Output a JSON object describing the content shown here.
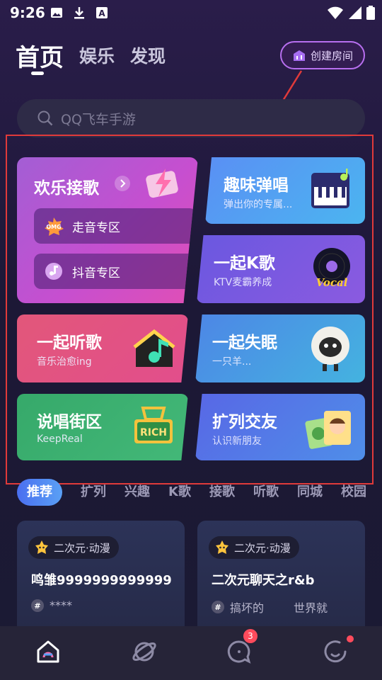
{
  "status_bar": {
    "time": "9:26"
  },
  "top_tabs": [
    {
      "label": "首页",
      "active": true
    },
    {
      "label": "娱乐"
    },
    {
      "label": "发现"
    }
  ],
  "create_room_label": "创建房间",
  "search": {
    "placeholder": "QQ飞车手游"
  },
  "cards": {
    "huanle": {
      "title": "欢乐接歌",
      "zones": [
        "走音专区",
        "抖音专区"
      ]
    },
    "quwei": {
      "title": "趣味弹唱",
      "sub": "弹出你的专属..."
    },
    "ktv": {
      "title": "一起K歌",
      "sub": "KTV麦霸养成",
      "badge": "Vocal"
    },
    "tingge": {
      "title": "一起听歌",
      "sub": "音乐治愈ing"
    },
    "shimian": {
      "title": "一起失眠",
      "sub": "一只羊..."
    },
    "shuochang": {
      "title": "说唱街区",
      "sub": "KeepReal",
      "badge": "RICH"
    },
    "kuolie": {
      "title": "扩列交友",
      "sub": "认识新朋友"
    }
  },
  "categories": [
    "推荐",
    "扩列",
    "兴趣",
    "K歌",
    "接歌",
    "听歌",
    "同城",
    "校园"
  ],
  "rooms": [
    {
      "tag": "二次元·动漫",
      "title": "鸣雏9999999999999",
      "meta": "****",
      "meta2": ""
    },
    {
      "tag": "二次元·动漫",
      "title": "二次元聊天之r&b",
      "meta": "搞坏的",
      "meta2": "世界就"
    }
  ],
  "nav": {
    "message_badge": "3"
  },
  "colors": {
    "accent": "#b86ff0",
    "annotation": "#e03a3a"
  }
}
